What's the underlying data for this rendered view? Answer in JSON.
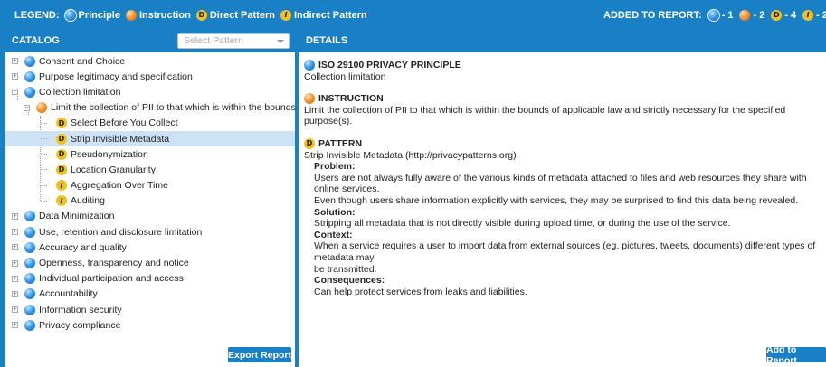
{
  "legend": {
    "title": "LEGEND:",
    "items": [
      {
        "icon": "principle-icon",
        "label": "Principle"
      },
      {
        "icon": "instruction-icon",
        "label": "Instruction"
      },
      {
        "icon": "direct-pattern-icon",
        "label": "Direct Pattern",
        "glyph": "D"
      },
      {
        "icon": "indirect-pattern-icon",
        "label": "Indirect Pattern",
        "glyph": "I"
      }
    ]
  },
  "added": {
    "label": "ADDED TO REPORT:",
    "counts": [
      "- 1",
      "- 2",
      "- 4",
      "- 2"
    ]
  },
  "catalog": {
    "title": "CATALOG",
    "select_placeholder": "Select Pattern",
    "export_button": "Export Report",
    "tree": [
      "Consent and Choice",
      "Purpose legitimacy and specification",
      "Collection limitation",
      "Limit the collection of PII to that which is within the bounds of ...",
      "Select Before You Collect",
      "Strip Invisible Metadata",
      "Pseudonymization",
      "Location Granularity",
      "Aggregation Over Time",
      "Auditing",
      "Data Minimization",
      "Use, retention and disclosure limitation",
      "Accuracy and quality",
      "Openness, transparency and notice",
      "Individual participation and access",
      "Accountability",
      "Information security",
      "Privacy compliance"
    ]
  },
  "details": {
    "title": "DETAILS",
    "principle_header": "ISO 29100 PRIVACY PRINCIPLE",
    "principle_text": "Collection limitation",
    "instruction_header": "INSTRUCTION",
    "instruction_text": "Limit the collection of PII to that which is within the bounds of applicable law and strictly necessary for the specified purpose(s).",
    "pattern_header": "PATTERN",
    "pattern_name": "Strip Invisible Metadata (http://privacypatterns.org)",
    "problem_label": "Problem:",
    "problem_text_1": "Users are not always fully aware of the various kinds of metadata attached to files and web resources they share with online services.",
    "problem_text_2": "Even though users share information explicitly with services, they may be surprised to find this data being revealed.",
    "solution_label": "Solution:",
    "solution_text": "Stripping all metadata that is not directly visible during upload time, or during the use of the service.",
    "context_label": "Context:",
    "context_text_1": "When a service requires a user to import data from external sources (eg. pictures, tweets, documents) different types of metadata may",
    "context_text_2": "be transmitted.",
    "consequences_label": "Consequences:",
    "consequences_text": "Can help protect services from leaks and liabilities.",
    "add_button": "Add to Report"
  }
}
